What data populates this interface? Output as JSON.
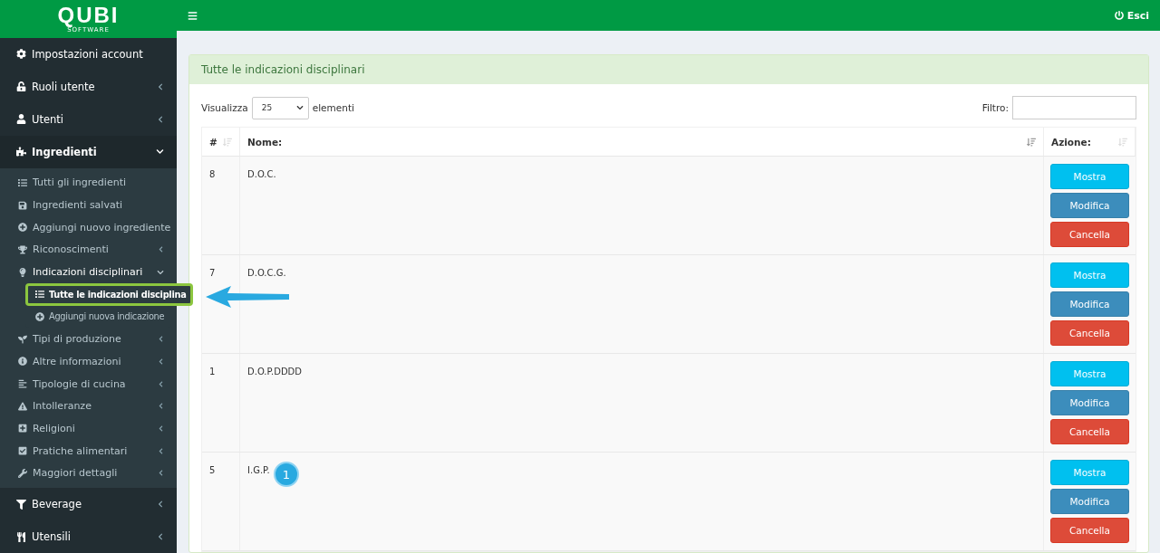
{
  "logo": {
    "name": "QUBI",
    "tagline": "SOFTWARE"
  },
  "topbar": {
    "logout": "Esci"
  },
  "sidebar": {
    "items": [
      {
        "label": "Impostazioni account"
      },
      {
        "label": "Ruoli utente",
        "expanded": false
      },
      {
        "label": "Utenti",
        "expanded": false
      },
      {
        "label": "Ingredienti",
        "expanded": true,
        "children": [
          {
            "label": "Tutti gli ingredienti"
          },
          {
            "label": "Ingredienti salvati"
          },
          {
            "label": "Aggiungi nuovo ingrediente"
          },
          {
            "label": "Riconoscimenti",
            "expanded": false
          },
          {
            "label": "Indicazioni disciplinari",
            "expanded": true,
            "children": [
              {
                "label": "Tutte le indicazioni disciplina",
                "selected": true
              },
              {
                "label": "Aggiungi nuova indicazione",
                "selected": false
              }
            ]
          },
          {
            "label": "Tipi di produzione",
            "expanded": false
          },
          {
            "label": "Altre informazioni",
            "expanded": false
          },
          {
            "label": "Tipologie di cucina",
            "expanded": false
          },
          {
            "label": "Intolleranze",
            "expanded": false
          },
          {
            "label": "Religioni",
            "expanded": false
          },
          {
            "label": "Pratiche alimentari",
            "expanded": false
          },
          {
            "label": "Maggiori dettagli",
            "expanded": false
          }
        ]
      },
      {
        "label": "Beverage",
        "expanded": false
      },
      {
        "label": "Utensili",
        "expanded": false
      }
    ]
  },
  "panel": {
    "title": "Tutte le indicazioni disciplinari",
    "length": {
      "before": "Visualizza",
      "value": "25",
      "after": "elementi"
    },
    "filter": {
      "label": "Filtro:"
    },
    "table": {
      "columns": [
        "#",
        "Nome:",
        "Azione:"
      ],
      "rows": [
        {
          "id": "8",
          "name": "D.O.C.",
          "actions": [
            "Mostra",
            "Modifica",
            "Cancella"
          ]
        },
        {
          "id": "7",
          "name": "D.O.C.G.",
          "actions": [
            "Mostra",
            "Modifica",
            "Cancella"
          ]
        },
        {
          "id": "1",
          "name": "D.O.P.DDDD",
          "actions": [
            "Mostra",
            "Modifica",
            "Cancella"
          ]
        },
        {
          "id": "5",
          "name": "I.G.P.",
          "actions": [
            "Mostra",
            "Modifica",
            "Cancella"
          ]
        }
      ]
    }
  },
  "annotation": {
    "badge": "1"
  }
}
